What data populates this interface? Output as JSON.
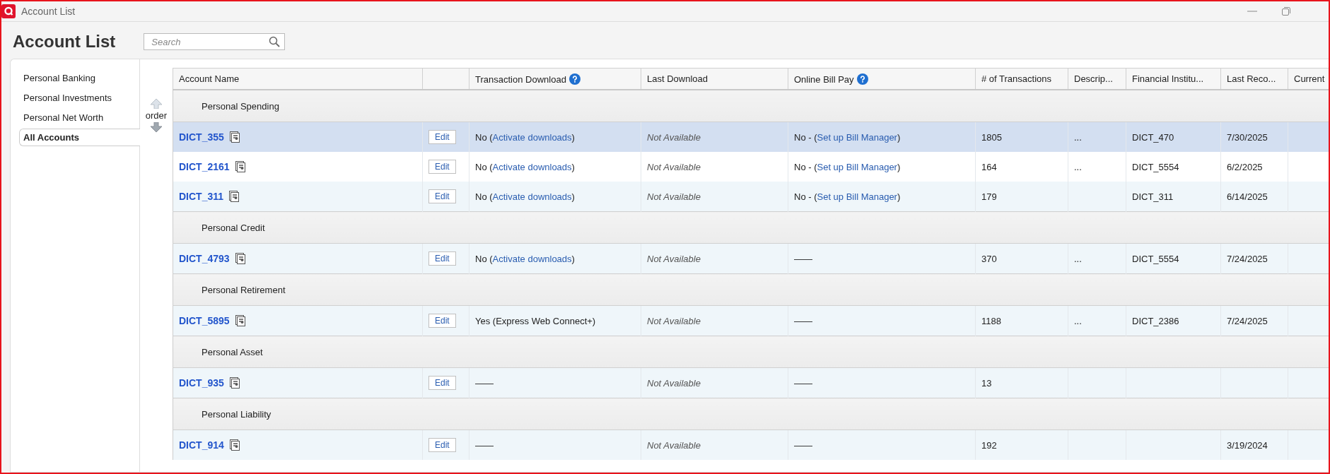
{
  "window": {
    "title": "Account List"
  },
  "page_title": "Account List",
  "search": {
    "placeholder": "Search"
  },
  "sidebar": {
    "items": [
      {
        "label": "Personal Banking",
        "selected": false
      },
      {
        "label": "Personal Investments",
        "selected": false
      },
      {
        "label": "Personal Net Worth",
        "selected": false
      },
      {
        "label": "All Accounts",
        "selected": true
      }
    ]
  },
  "order_label": "order",
  "table": {
    "columns": [
      {
        "label": "Account Name",
        "help": false
      },
      {
        "help": false
      },
      {
        "label": "Transaction Download",
        "help": true
      },
      {
        "label": "Last Download",
        "help": false
      },
      {
        "label": "Online Bill Pay",
        "help": true
      },
      {
        "label": "# of Transactions",
        "help": false
      },
      {
        "label": "Descrip...",
        "help": false
      },
      {
        "label": "Financial Institu...",
        "help": false
      },
      {
        "label": "Last Reco...",
        "help": false
      },
      {
        "label": "Current",
        "help": false
      }
    ],
    "groups": [
      {
        "name": "Personal Spending",
        "rows": [
          {
            "account": "DICT_355",
            "selected": true,
            "edit": "Edit",
            "download": [
              {
                "kind": "text",
                "text": "No ("
              },
              {
                "kind": "link",
                "text": "Activate downloads"
              },
              {
                "kind": "text",
                "text": ")"
              }
            ],
            "last_download": "Not Available",
            "bill_pay": [
              {
                "kind": "text",
                "text": "No - ("
              },
              {
                "kind": "link",
                "text": "Set up Bill Manager"
              },
              {
                "kind": "text",
                "text": ")"
              }
            ],
            "transactions": "1805",
            "description": "...",
            "institution": "DICT_470",
            "last_reconciled": "7/30/2025"
          },
          {
            "account": "DICT_2161",
            "selected": false,
            "edit": "Edit",
            "download": [
              {
                "kind": "text",
                "text": "No ("
              },
              {
                "kind": "link",
                "text": "Activate downloads"
              },
              {
                "kind": "text",
                "text": ")"
              }
            ],
            "last_download": "Not Available",
            "bill_pay": [
              {
                "kind": "text",
                "text": "No - ("
              },
              {
                "kind": "link",
                "text": "Set up Bill Manager"
              },
              {
                "kind": "text",
                "text": ")"
              }
            ],
            "transactions": "164",
            "description": "...",
            "institution": "DICT_5554",
            "last_reconciled": "6/2/2025"
          },
          {
            "account": "DICT_311",
            "selected": false,
            "edit": "Edit",
            "download": [
              {
                "kind": "text",
                "text": "No ("
              },
              {
                "kind": "link",
                "text": "Activate downloads"
              },
              {
                "kind": "text",
                "text": ")"
              }
            ],
            "last_download": "Not Available",
            "bill_pay": [
              {
                "kind": "text",
                "text": "No - ("
              },
              {
                "kind": "link",
                "text": "Set up Bill Manager"
              },
              {
                "kind": "text",
                "text": ")"
              }
            ],
            "transactions": "179",
            "institution": "DICT_311",
            "last_reconciled": "6/14/2025"
          }
        ]
      },
      {
        "name": "Personal Credit",
        "rows": [
          {
            "account": "DICT_4793",
            "selected": false,
            "edit": "Edit",
            "download": [
              {
                "kind": "text",
                "text": "No ("
              },
              {
                "kind": "link",
                "text": "Activate downloads"
              },
              {
                "kind": "text",
                "text": ")"
              }
            ],
            "last_download": "Not Available",
            "bill_pay": [
              {
                "kind": "text",
                "text": "——"
              }
            ],
            "transactions": "370",
            "description": "...",
            "institution": "DICT_5554",
            "last_reconciled": "7/24/2025"
          }
        ]
      },
      {
        "name": "Personal Retirement",
        "rows": [
          {
            "account": "DICT_5895",
            "selected": false,
            "edit": "Edit",
            "download": [
              {
                "kind": "text",
                "text": "Yes (Express Web Connect+)"
              }
            ],
            "last_download": "Not Available",
            "bill_pay": [
              {
                "kind": "text",
                "text": "——"
              }
            ],
            "transactions": "1188",
            "description": "...",
            "institution": "DICT_2386",
            "last_reconciled": "7/24/2025"
          }
        ]
      },
      {
        "name": "Personal Asset",
        "rows": [
          {
            "account": "DICT_935",
            "selected": false,
            "edit": "Edit",
            "download": [
              {
                "kind": "text",
                "text": "——"
              }
            ],
            "last_download": "Not Available",
            "bill_pay": [
              {
                "kind": "text",
                "text": "——"
              }
            ],
            "transactions": "13"
          }
        ]
      },
      {
        "name": "Personal Liability",
        "rows": [
          {
            "account": "DICT_914",
            "selected": false,
            "edit": "Edit",
            "download": [
              {
                "kind": "text",
                "text": "——"
              }
            ],
            "last_download": "Not Available",
            "bill_pay": [
              {
                "kind": "text",
                "text": "——"
              }
            ],
            "transactions": "192",
            "last_reconciled": "3/19/2024"
          }
        ]
      }
    ]
  }
}
